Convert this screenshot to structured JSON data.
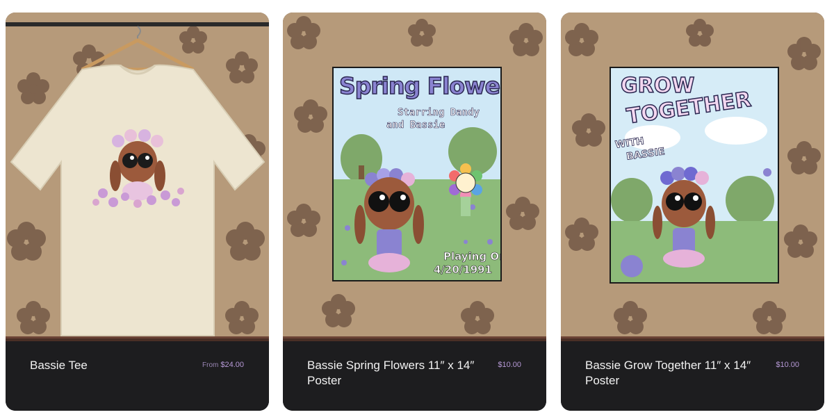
{
  "products": [
    {
      "name": "Bassie Tee",
      "price_prefix": "From",
      "price": "$24.00",
      "image": "bassie-tee-photo"
    },
    {
      "name": "Bassie Spring Flowers 11″ x 14″ Poster",
      "price": "$10.00",
      "image": "spring-flowers-poster-photo",
      "poster": {
        "title": "Spring Flowers",
        "subtitle_1": "Starring Dandy",
        "subtitle_2": "and Bassie",
        "date_label": "Playing On",
        "date": "4/20/1991"
      }
    },
    {
      "name": "Bassie Grow Together 11″ x 14″ Poster",
      "price": "$10.00",
      "image": "grow-together-poster-photo",
      "poster": {
        "title_1": "GROW",
        "title_2": "TOGETHER",
        "subtitle_1": "WITH",
        "subtitle_2": "BASSIE"
      }
    }
  ],
  "colors": {
    "card_bg": "#1d1d1f",
    "price": "#b699d6",
    "wall": "#b69a7a",
    "flower_pattern": "#6b5040",
    "shelf": "#4a2f26"
  }
}
